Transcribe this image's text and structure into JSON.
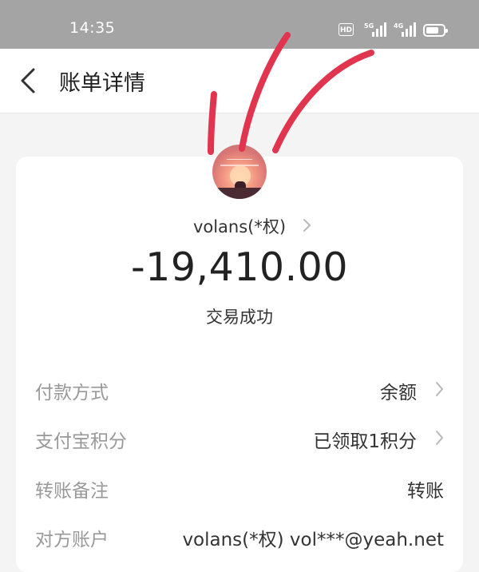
{
  "status_bar": {
    "time": "14:35",
    "hd_label": "HD",
    "network_1": "5G",
    "network_2": "4G",
    "battery_level": 0.75
  },
  "header": {
    "title": "账单详情",
    "back_icon": "chevron-left-icon"
  },
  "transaction": {
    "counterparty": "volans(*权)",
    "amount": "-19,410.00",
    "status": "交易成功"
  },
  "details": [
    {
      "label": "付款方式",
      "value": "余额",
      "has_chevron": true
    },
    {
      "label": "支付宝积分",
      "value": "已领取1积分",
      "has_chevron": true
    },
    {
      "label": "转账备注",
      "value": "转账",
      "has_chevron": false
    },
    {
      "label": "对方账户",
      "value": "volans(*权) vol***@yeah.net",
      "has_chevron": false
    }
  ],
  "colors": {
    "status_bar": "#a4a4a4",
    "background": "#f4f4f4",
    "card": "#ffffff",
    "label": "#999999",
    "scribble": "#e0344f"
  }
}
